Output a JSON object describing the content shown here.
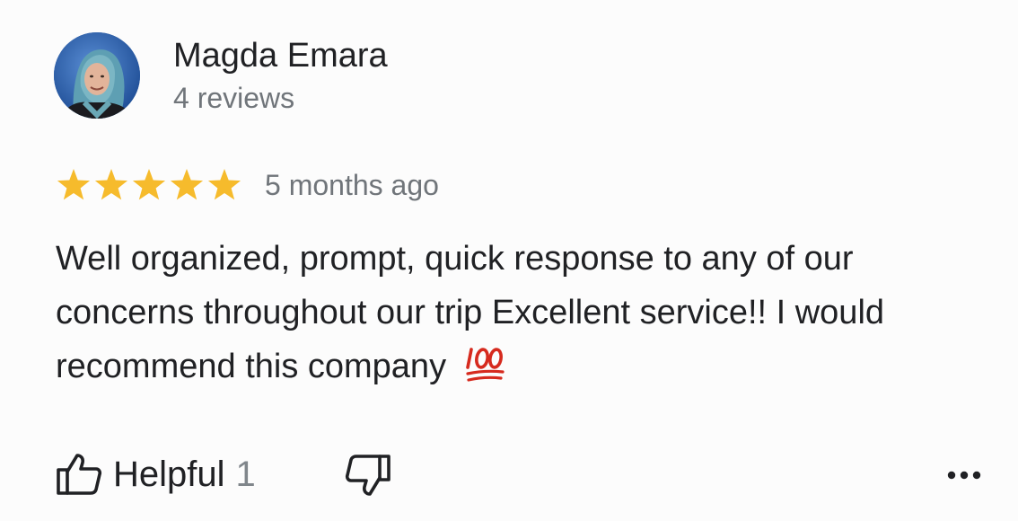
{
  "review": {
    "author": {
      "name": "Magda Emara",
      "review_count": "4 reviews"
    },
    "rating": {
      "stars": 5,
      "max_stars": 5,
      "star_color": "#f6bb2c"
    },
    "timestamp": "5 months ago",
    "text": "Well organized, prompt, quick response to any of our concerns throughout our trip Excellent service!! I would recommend this company",
    "text_emoji": "💯"
  },
  "actions": {
    "helpful_label": "Helpful",
    "helpful_count": "1",
    "thumb_up_icon": "thumbs-up-outline-icon",
    "thumb_down_icon": "thumbs-down-outline-icon",
    "more_icon": "more-horizontal-icon"
  }
}
